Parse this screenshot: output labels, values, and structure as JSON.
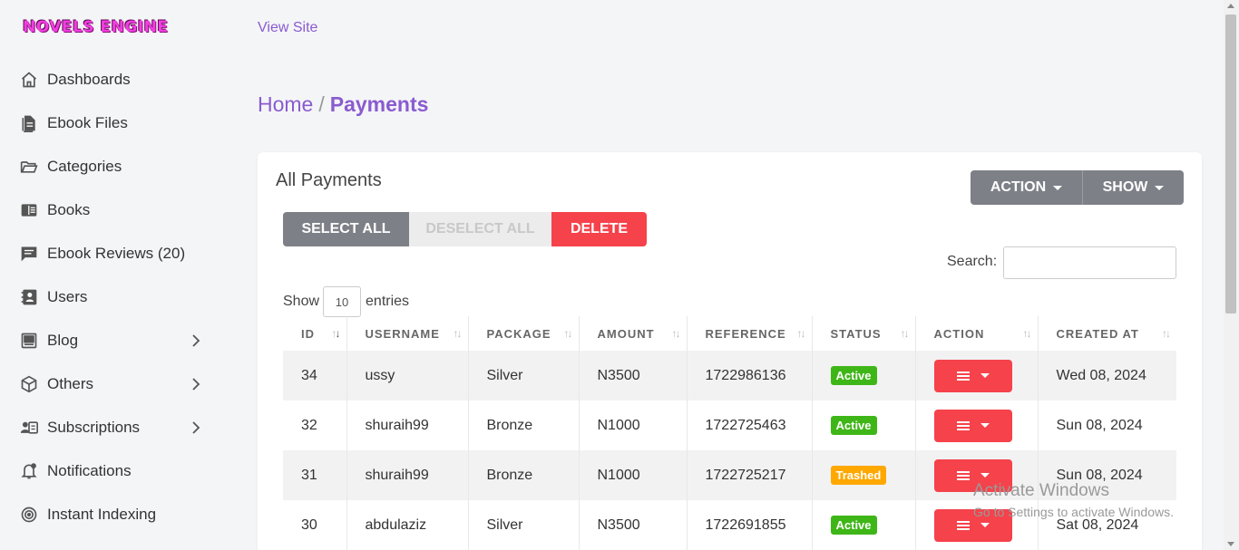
{
  "brand": {
    "logo_text": "NOVELS ENGINE"
  },
  "sidebar": {
    "items": [
      {
        "label": "Dashboards",
        "icon": "home-icon",
        "has_children": false
      },
      {
        "label": "Ebook Files",
        "icon": "file-icon",
        "has_children": false
      },
      {
        "label": "Categories",
        "icon": "folder-open-icon",
        "has_children": false
      },
      {
        "label": "Books",
        "icon": "book-icon",
        "has_children": false
      },
      {
        "label": "Ebook Reviews (20)",
        "icon": "comment-icon",
        "has_children": false
      },
      {
        "label": "Users",
        "icon": "address-book-icon",
        "has_children": false
      },
      {
        "label": "Blog",
        "icon": "blog-icon",
        "has_children": true
      },
      {
        "label": "Others",
        "icon": "cube-icon",
        "has_children": true
      },
      {
        "label": "Subscriptions",
        "icon": "user-id-icon",
        "has_children": true
      },
      {
        "label": "Notifications",
        "icon": "bell-icon",
        "has_children": false
      },
      {
        "label": "Instant Indexing",
        "icon": "target-icon",
        "has_children": false
      }
    ]
  },
  "header": {
    "view_site": "View Site"
  },
  "breadcrumb": {
    "home": "Home",
    "separator": "/",
    "current": "Payments"
  },
  "card": {
    "title": "All Payments",
    "action_label": "ACTION",
    "show_label": "SHOW",
    "select_all": "SELECT ALL",
    "deselect_all": "DESELECT ALL",
    "delete": "DELETE",
    "search_label": "Search:",
    "search_value": "",
    "show_prefix": "Show",
    "show_value": "10",
    "show_suffix": "entries"
  },
  "table": {
    "columns": [
      "ID",
      "USERNAME",
      "PACKAGE",
      "AMOUNT",
      "REFERENCE",
      "STATUS",
      "ACTION",
      "CREATED AT"
    ],
    "rows": [
      {
        "id": "34",
        "username": "ussy",
        "package": "Silver",
        "amount": "N3500",
        "reference": "1722986136",
        "status": "Active",
        "created": "Wed 08, 2024"
      },
      {
        "id": "32",
        "username": "shuraih99",
        "package": "Bronze",
        "amount": "N1000",
        "reference": "1722725463",
        "status": "Active",
        "created": "Sun 08, 2024"
      },
      {
        "id": "31",
        "username": "shuraih99",
        "package": "Bronze",
        "amount": "N1000",
        "reference": "1722725217",
        "status": "Trashed",
        "created": "Sun 08, 2024"
      },
      {
        "id": "30",
        "username": "abdulaziz",
        "package": "Silver",
        "amount": "N3500",
        "reference": "1722691855",
        "status": "Active",
        "created": "Sat 08, 2024"
      }
    ]
  },
  "watermark": {
    "line1": "Activate Windows",
    "line2": "Go to Settings to activate Windows."
  },
  "colors": {
    "accent": "#8a5bd0",
    "danger": "#f5424b",
    "active": "#3fb618",
    "trashed": "#ffa800",
    "gray_button": "#7d8087"
  }
}
